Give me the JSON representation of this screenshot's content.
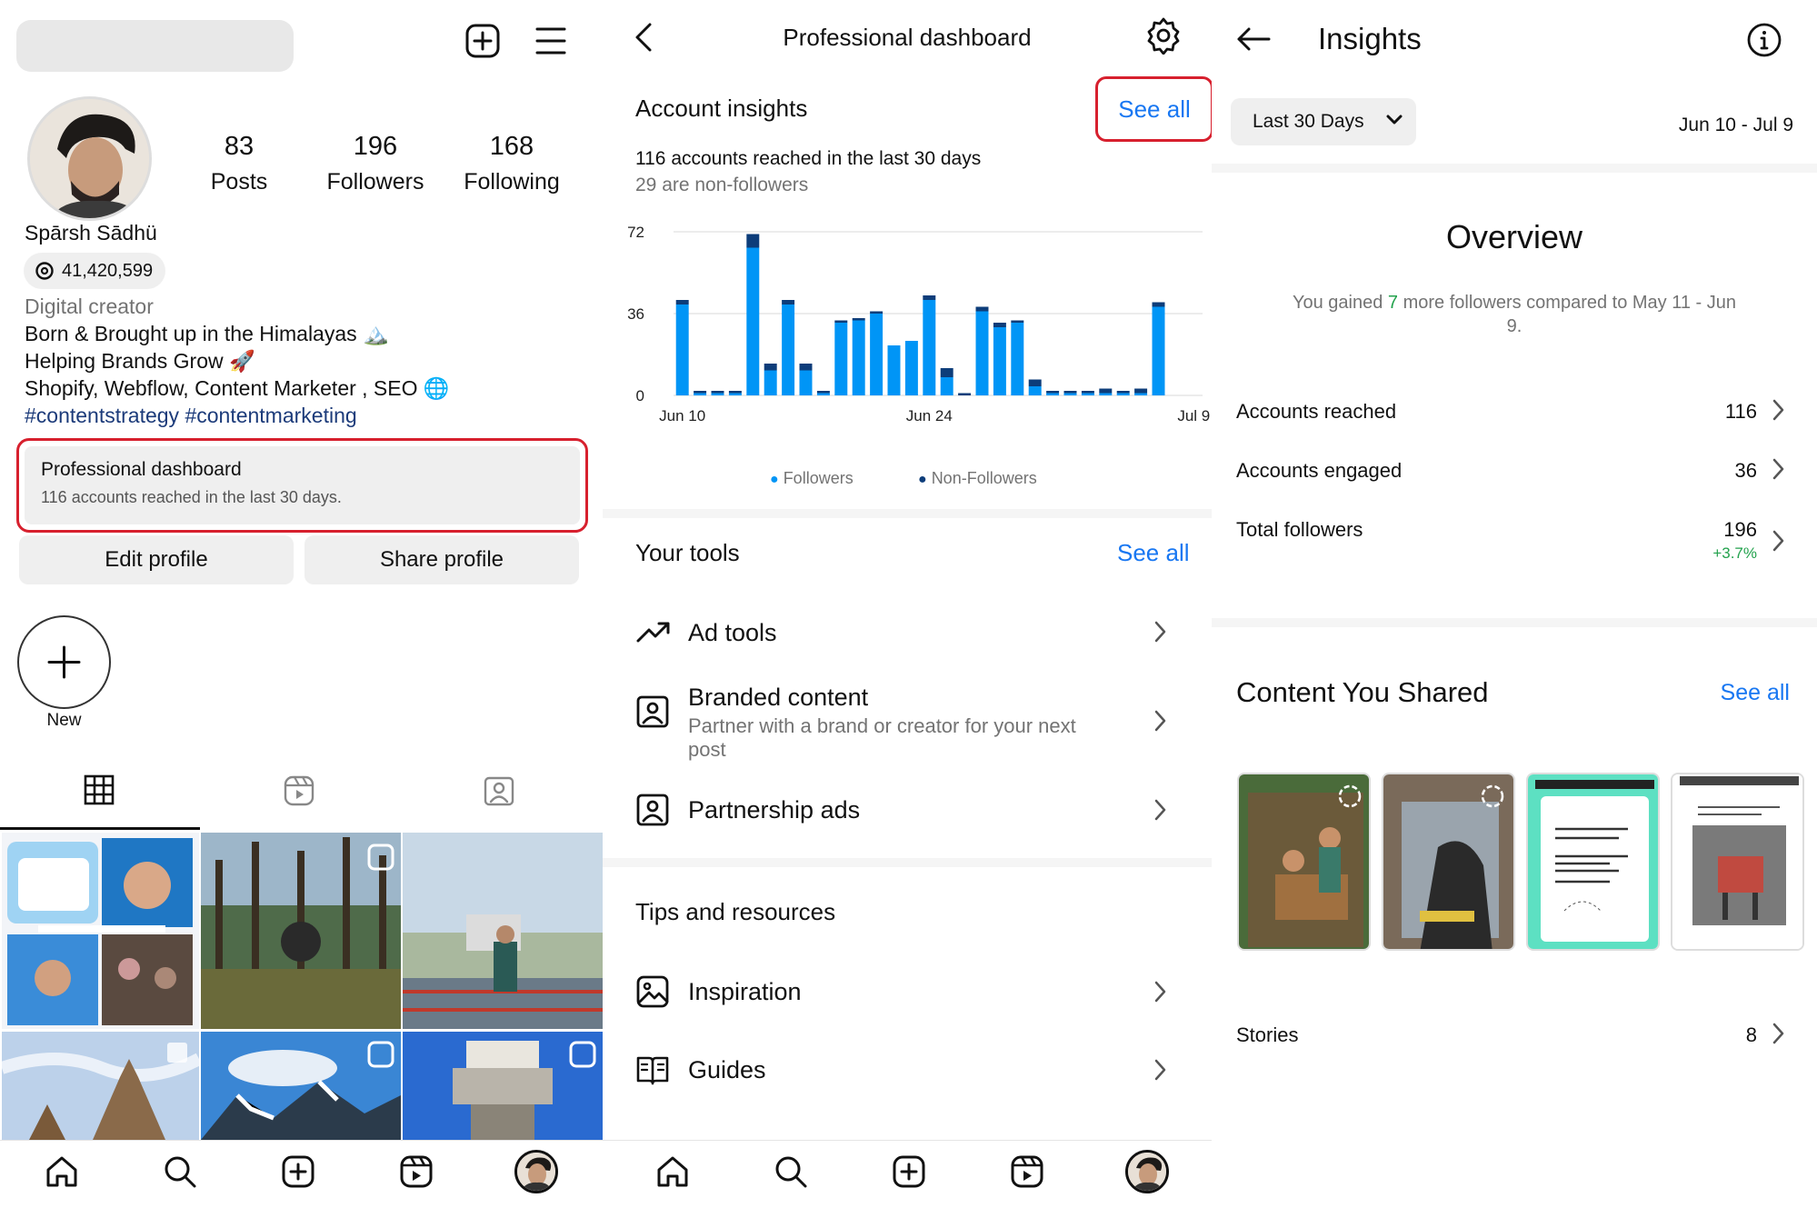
{
  "profile": {
    "stats": [
      {
        "value": "83",
        "label": "Posts"
      },
      {
        "value": "196",
        "label": "Followers"
      },
      {
        "value": "168",
        "label": "Following"
      }
    ],
    "name": "Spārsh Sādhü",
    "threads_count": "41,420,599",
    "category": "Digital creator",
    "bio": [
      "Born & Brought up in the Himalayas 🏔️",
      "Helping Brands Grow 🚀",
      "Shopify, Webflow, Content Marketer , SEO 🌐"
    ],
    "hashtags": "#contentstrategy #contentmarketing",
    "pro_dashboard": {
      "title": "Professional dashboard",
      "subtitle": "116 accounts reached in the last 30 days."
    },
    "edit_label": "Edit profile",
    "share_label": "Share profile",
    "new_label": "New"
  },
  "dashboard": {
    "title": "Professional dashboard",
    "insights_title": "Account insights",
    "see_all": "See all",
    "reach_text": "116 accounts reached in the last 30 days",
    "non_followers_text": "29 are non-followers",
    "legend_followers": "Followers",
    "legend_non_followers": "Non-Followers",
    "tools_title": "Your tools",
    "tools": [
      {
        "title": "Ad tools",
        "icon": "trending-up-icon"
      },
      {
        "title": "Branded content",
        "sub1": "Partner with a brand or creator for your next",
        "sub2": "post",
        "icon": "branded-content-icon"
      },
      {
        "title": "Partnership ads",
        "icon": "partnership-ads-icon"
      }
    ],
    "tips_title": "Tips and resources",
    "tips": [
      {
        "title": "Inspiration",
        "icon": "image-icon"
      },
      {
        "title": "Guides",
        "icon": "book-icon"
      }
    ]
  },
  "chart_data": {
    "type": "bar",
    "stacked": true,
    "y_ticks": [
      0,
      36,
      72
    ],
    "ylim": [
      0,
      72
    ],
    "x_tick_labels": [
      "Jun 10",
      "Jun 24",
      "Jul 9"
    ],
    "x_tick_indices": [
      0,
      14,
      29
    ],
    "series": [
      {
        "name": "Followers",
        "color": "#0095f6",
        "values": [
          40,
          1,
          1,
          1,
          65,
          11,
          40,
          11,
          1,
          32,
          33,
          36,
          22,
          24,
          42,
          8,
          0,
          37,
          30,
          32,
          4,
          1,
          1,
          1,
          1,
          1,
          1,
          39,
          0,
          0
        ]
      },
      {
        "name": "Non-Followers",
        "color": "#0d3d7a",
        "values": [
          2,
          1,
          1,
          1,
          6,
          3,
          2,
          3,
          1,
          1,
          1,
          1,
          0,
          0,
          2,
          4,
          1,
          2,
          2,
          1,
          3,
          1,
          1,
          1,
          2,
          1,
          2,
          2,
          0,
          0
        ]
      }
    ]
  },
  "insights": {
    "title": "Insights",
    "range_label": "Last 30 Days",
    "date_range": "Jun 10 - Jul 9",
    "overview_title": "Overview",
    "gained_prefix": "You gained ",
    "gained_value": "7",
    "gained_suffix": " more followers compared to May 11 - Jun",
    "gained_line2": "9.",
    "rows": [
      {
        "label": "Accounts reached",
        "value": "116"
      },
      {
        "label": "Accounts engaged",
        "value": "36"
      },
      {
        "label": "Total followers",
        "value": "196",
        "delta": "+3.7%"
      }
    ],
    "content_title": "Content You Shared",
    "see_all": "See all",
    "stories_label": "Stories",
    "stories_value": "8"
  },
  "colors": {
    "accent": "#1877f2",
    "highlight": "#d7202e",
    "positive": "#23a24d"
  }
}
